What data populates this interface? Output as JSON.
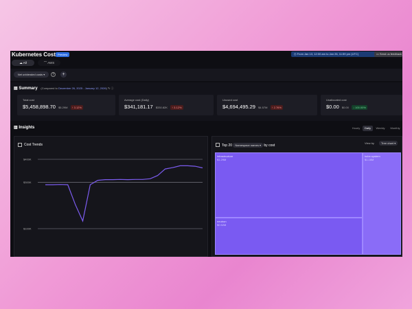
{
  "app": {
    "title": "Kubernetes Costs",
    "badge": "Preview"
  },
  "date_range": {
    "label": "From Jan 13, 12:00 am to Jan 26, 11:59 pm (UTC)"
  },
  "feedback": {
    "label": "Send us feedback"
  },
  "cloud_tabs": [
    {
      "label": "All"
    },
    {
      "label": "AWS"
    }
  ],
  "filters": {
    "pill_label": "Net unblended costs",
    "add_label": "+"
  },
  "summary": {
    "title": "Summary",
    "compared_prefix": "(Compared to",
    "compared_range": "December 26, 2025 - January 12, 2026",
    "compared_suffix": ")",
    "cards": [
      {
        "label": "Total cost",
        "value": "$5,458,898.70",
        "prev": "$5.29M",
        "change": "3.12%",
        "dir": "up"
      },
      {
        "label": "Average cost (Daily)",
        "value": "$341,181.17",
        "prev": "$330.82K",
        "change": "3.12%",
        "dir": "up"
      },
      {
        "label": "Unused cost",
        "value": "$4,694,495.29",
        "prev": "$4.57M",
        "change": "2.76%",
        "dir": "up"
      },
      {
        "label": "Unallocated cost",
        "value": "$0.00",
        "prev": "$0.00",
        "change": "100.00%",
        "dir": "down"
      }
    ]
  },
  "insights": {
    "title": "Insights",
    "granularity": [
      {
        "label": "Hourly"
      },
      {
        "label": "Daily"
      },
      {
        "label": "Weekly"
      },
      {
        "label": "Monthly"
      }
    ],
    "active_granularity": "Daily"
  },
  "cost_trends": {
    "title": "Cost Trends",
    "chart_data": {
      "type": "line",
      "title": "Cost Trends",
      "y_tick_labels": [
        "$400K",
        "$300K",
        "$100K"
      ],
      "series": [
        {
          "color": "#7c5cf0",
          "values": [
            290,
            290,
            291,
            290,
            205,
            133,
            290,
            309,
            312,
            312,
            313,
            312,
            313,
            313,
            316,
            330,
            358,
            364,
            372,
            372,
            370,
            363
          ]
        }
      ]
    }
  },
  "top20": {
    "prefix": "Top 20",
    "group_label": "Namespace names",
    "suffix": "by cost",
    "view_by_label": "View by",
    "view_option": "Tree chart",
    "cells": [
      {
        "name": "infrastructure",
        "cost": "$1.29M"
      },
      {
        "name": "kube-system",
        "cost": "$1.16M"
      },
      {
        "name": "neutron",
        "cost": "$0.52M"
      }
    ]
  },
  "colors": {
    "accent": "#7a5af2",
    "background": "#0e0e13"
  }
}
